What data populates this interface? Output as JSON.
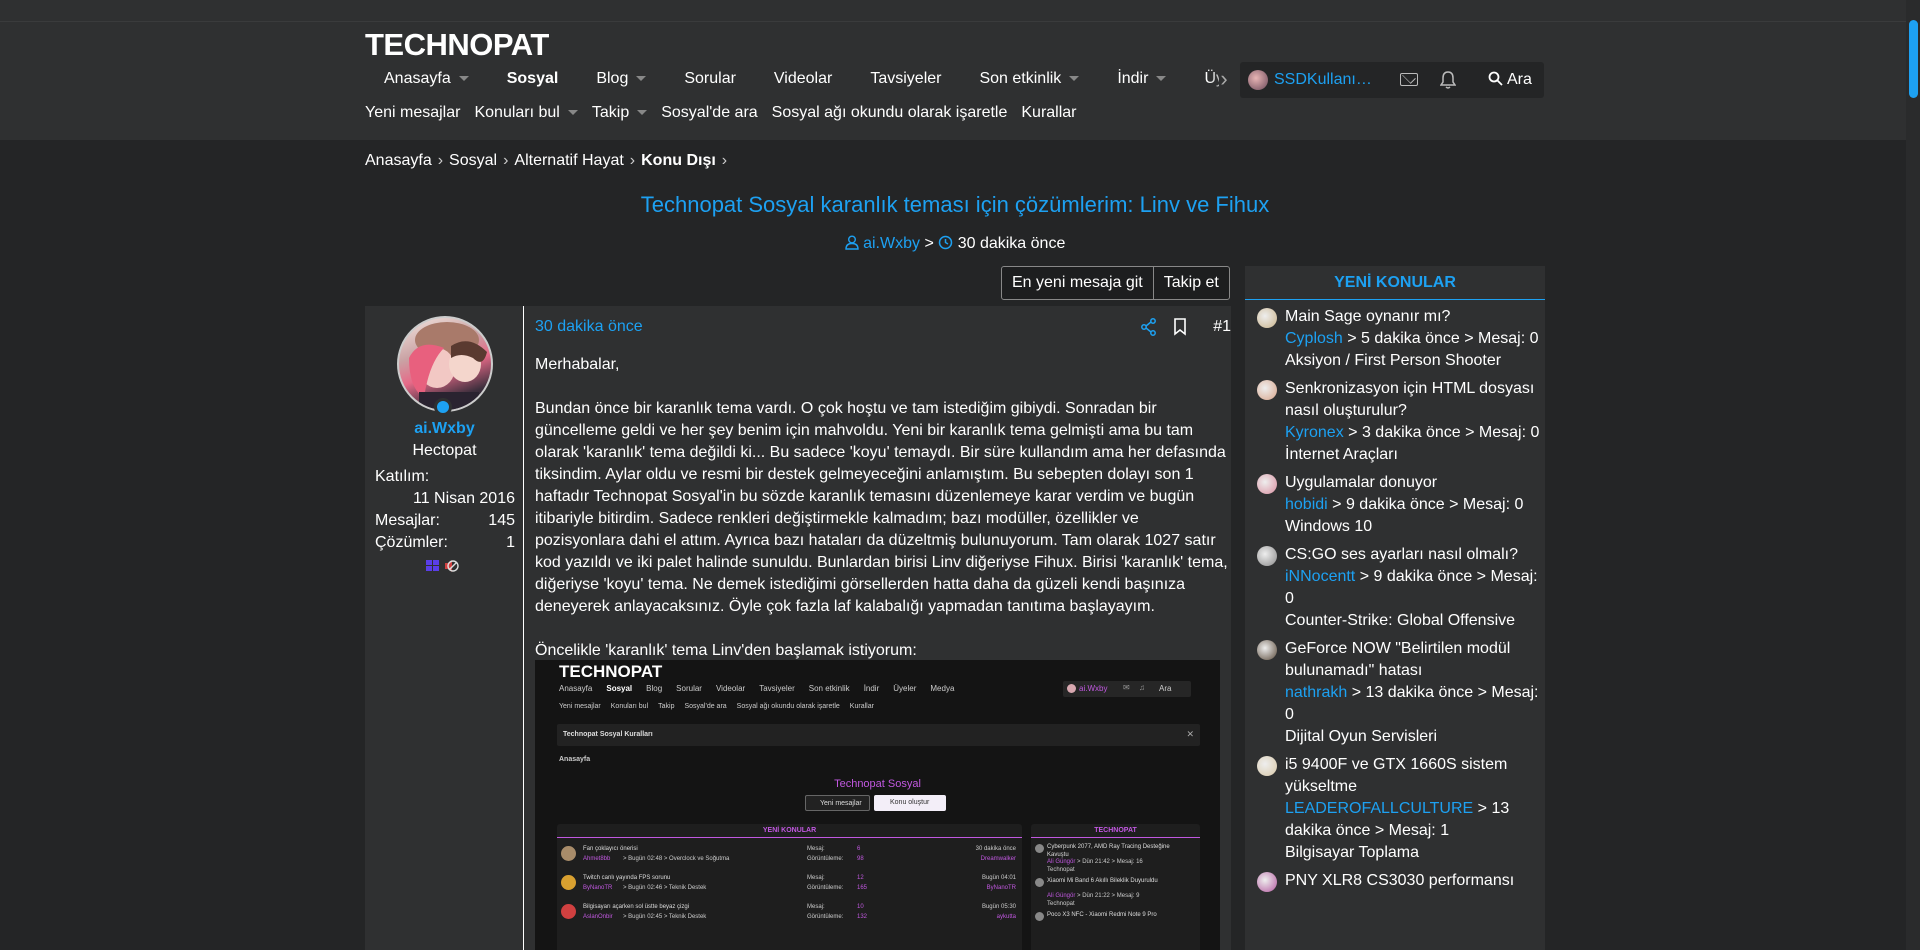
{
  "header": {
    "logo": "TECHNOPAT",
    "nav": [
      {
        "label": "Anasayfa",
        "caret": true,
        "active": false
      },
      {
        "label": "Sosyal",
        "caret": false,
        "active": true
      },
      {
        "label": "Blog",
        "caret": true,
        "active": false
      },
      {
        "label": "Sorular",
        "caret": false,
        "active": false
      },
      {
        "label": "Videolar",
        "caret": false,
        "active": false
      },
      {
        "label": "Tavsiyeler",
        "caret": false,
        "active": false
      },
      {
        "label": "Son etkinlik",
        "caret": true,
        "active": false
      },
      {
        "label": "İndir",
        "caret": true,
        "active": false
      },
      {
        "label": "Üyeler",
        "caret": false,
        "active": false
      }
    ],
    "username": "SSDKullanıcısı",
    "search_label": "Ara",
    "subnav": [
      "Yeni mesajlar",
      "Konuları bul",
      "Takip",
      "Sosyal'de ara",
      "Sosyal ağı okundu olarak işaretle",
      "Kurallar"
    ]
  },
  "breadcrumb": [
    "Anasayfa",
    "Sosyal",
    "Alternatif Hayat",
    "Konu Dışı"
  ],
  "thread": {
    "title": "Technopat Sosyal karanlık teması için çözümlerim: Linv ve Fihux",
    "author": "ai.Wxby",
    "sep": ">",
    "time": "30 dakika önce"
  },
  "buttons": {
    "latest": "En yeni mesaja git",
    "follow": "Takip et"
  },
  "post": {
    "user": {
      "name": "ai.Wxby",
      "rank": "Hectopat"
    },
    "stats": {
      "joined_label": "Katılım:",
      "joined_value": "11 Nisan 2016",
      "messages_label": "Mesajlar:",
      "messages_value": "145",
      "solutions_label": "Çözümler:",
      "solutions_value": "1"
    },
    "time": "30 dakika önce",
    "number": "#1",
    "paragraphs": [
      "Merhabalar,",
      "Bundan önce bir karanlık tema vardı. O çok hoştu ve tam istediğim gibiydi. Sonradan bir güncelleme geldi ve her şey benim için mahvoldu. Yeni bir karanlık tema gelmişti ama bu tam olarak 'karanlık' tema değildi ki... Bu sadece 'koyu' temaydı. Bir süre kullandım ama her defasında tiksindim. Aylar oldu ve resmi bir destek gelmeyeceğini anlamıştım. Bu sebepten dolayı son 1 haftadır Technopat Sosyal'in bu sözde karanlık temasını düzenlemeye karar verdim ve bugün itibariyle bitirdim. Sadece renkleri değiştirmekle kalmadım; bazı modüller, özellikler ve pozisyonlara dahi el attım. Ayrıca bazı hataları da düzeltmiş bulunuyorum. Tam olarak 1027 satır kod yazıldı ve iki palet halinde sunuldu. Bunlardan birisi Linv diğeriyse Fihux. Birisi 'karanlık' tema, diğeriyse 'koyu' tema. Ne demek istediğimi görsellerden hatta daha da güzeli kendi başınıza deneyerek anlayacaksınız. Öyle çok fazla laf kalabalığı yapmadan tanıtıma başlayayım.",
      "Öncelikle 'karanlık' tema Linv'den başlamak istiyorum:"
    ]
  },
  "screenshot": {
    "logo": "TECHNOPAT",
    "nav": [
      "Anasayfa",
      "Sosyal",
      "Blog",
      "Sorular",
      "Videolar",
      "Tavsiyeler",
      "Son etkinlik",
      "İndir",
      "Üyeler",
      "Medya"
    ],
    "user": "ai.Wxby",
    "search": "Ara",
    "subnav": [
      "Yeni mesajlar",
      "Konuları bul",
      "Takip",
      "Sosyal'de ara",
      "Sosyal ağı okundu olarak işaretle",
      "Kurallar"
    ],
    "notice": "Technopat Sosyal Kuralları",
    "crumb": "Anasayfa",
    "title": "Technopat Sosyal",
    "btn1": "Yeni mesajlar",
    "btn2": "Konu oluştur",
    "left_header": "YENİ KONULAR",
    "right_header": "TECHNOPAT",
    "rows": [
      {
        "title": "Fan çoklayıcı önerisi",
        "meta_user": "Ahmet8bb",
        "meta": "> Bugün 02:48 > Overclock ve Soğutma",
        "l1": "Mesaj:",
        "v1": "6",
        "l2": "Görüntüleme:",
        "v2": "98",
        "time": "30 dakika önce",
        "last": "Dreamwalker"
      },
      {
        "title": "Twitch canlı yayında FPS sorunu",
        "meta_user": "ByNanoTR",
        "meta": "> Bugün 02:46 > Teknik Destek",
        "l1": "Mesaj:",
        "v1": "12",
        "l2": "Görüntüleme:",
        "v2": "165",
        "time": "Bugün 04:01",
        "last": "ByNanoTR"
      },
      {
        "title": "Bilgisayarı açarken sol üstte beyaz çizgi",
        "meta_user": "AslanOnbir",
        "meta": "> Bugün 02:45 > Teknik Destek",
        "l1": "Mesaj:",
        "v1": "10",
        "l2": "Görüntüleme:",
        "v2": "132",
        "time": "Bugün 05:30",
        "last": "aykutta"
      }
    ],
    "right_items": [
      {
        "title": "Cyberpunk 2077, AMD Ray Tracing Desteğine Kavuştu",
        "user": "Ali Güngör",
        "meta": "> Dün 21:42 > Mesaj: 16",
        "forum": "Technopat"
      },
      {
        "title": "Xiaomi Mi Band 6 Akıllı Bileklik Duyuruldu",
        "user": "Ali Güngör",
        "meta": "> Dün 21:22 > Mesaj: 9",
        "forum": "Technopat"
      },
      {
        "title": "Poco X3 NFC - Xiaomi Redmi Note 9 Pro",
        "user": "",
        "meta": "",
        "forum": ""
      }
    ]
  },
  "sidebar": {
    "title": "YENİ KONULAR",
    "items": [
      {
        "title": "Main Sage oynanır mı?",
        "user": "Cyplosh",
        "meta": "> 5 dakika önce > Mesaj: 0",
        "forum": "Aksiyon / First Person Shooter",
        "color": "#c9b38a"
      },
      {
        "title": "Senkronizasyon için HTML dosyası nasıl oluşturulur?",
        "user": "Kyronex",
        "meta": "> 3 dakika önce > Mesaj: 0",
        "forum": "İnternet Araçları",
        "color": "#d8a48a"
      },
      {
        "title": "Uygulamalar donuyor",
        "user": "hobidi",
        "meta": "> 9 dakika önce > Mesaj: 0",
        "forum": "Windows 10",
        "color": "#d98fa0"
      },
      {
        "title": "CS:GO ses ayarları nasıl olmalı?",
        "user": "iNNocentt",
        "meta": "> 9 dakika önce > Mesaj: 0",
        "forum": "Counter-Strike: Global Offensive",
        "color": "#8a8a8a"
      },
      {
        "title": "GeForce NOW \"Belirtilen modül bulunamadı\" hatası",
        "user": "nathrakh",
        "meta": "> 13 dakika önce > Mesaj: 0",
        "forum": "Dijital Oyun Servisleri",
        "color": "#5a4a3a"
      },
      {
        "title": "i5 9400F ve GTX 1660S sistem yükseltme",
        "user": "LEADEROFALLCULTURE",
        "meta": "> 13 dakika önce > Mesaj: 1",
        "forum": "Bilgisayar Toplama",
        "color": "#d8c8a8"
      },
      {
        "title": "PNY XLR8 CS3030 performansı",
        "user": "",
        "meta": "",
        "forum": "",
        "color": "#b45aa0"
      }
    ]
  },
  "colors": {
    "accent": "#1da1f2",
    "background": "#242526",
    "panel": "#2f3031",
    "screenshot_accent": "#c158e0"
  }
}
